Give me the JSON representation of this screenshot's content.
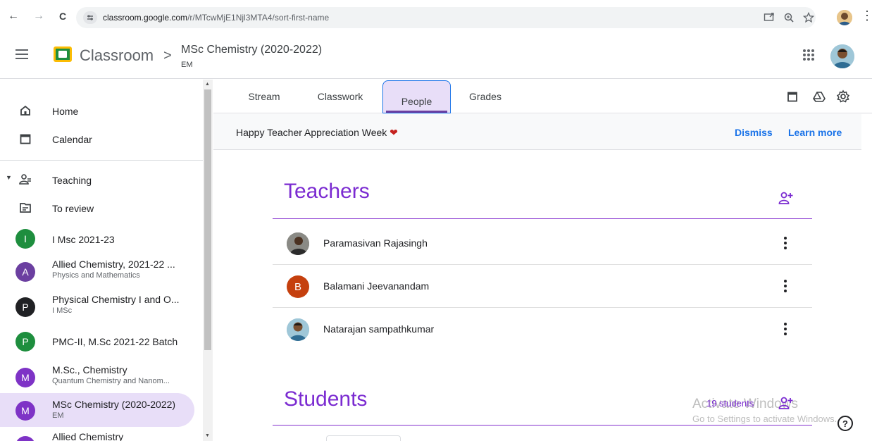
{
  "browser": {
    "back_icon": "←",
    "forward_icon": "→",
    "reload_icon": "C",
    "url_host": "classroom.google.com",
    "url_path": "/r/MTcwMjE1Njl3MTA4/sort-first-name",
    "kebab": "⋮"
  },
  "header": {
    "app_title": "Classroom",
    "crumb_separator": ">",
    "course_title": "MSc Chemistry (2020-2022)",
    "course_section": "EM"
  },
  "sidebar": {
    "home": "Home",
    "calendar": "Calendar",
    "teaching": "Teaching",
    "to_review": "To review",
    "courses": [
      {
        "letter": "I",
        "color": "#1e8e3e",
        "name": "I Msc 2021-23",
        "sub": ""
      },
      {
        "letter": "A",
        "color": "#6b3fa0",
        "name": "Allied Chemistry, 2021-22 ...",
        "sub": "Physics and Mathematics"
      },
      {
        "letter": "P",
        "color": "#202124",
        "name": "Physical Chemistry I and O...",
        "sub": "I MSc"
      },
      {
        "letter": "P",
        "color": "#1e8e3e",
        "name": "PMC-II, M.Sc 2021-22 Batch",
        "sub": ""
      },
      {
        "letter": "M",
        "color": "#7e33c6",
        "name": "M.Sc., Chemistry",
        "sub": "Quantum Chemistry and Nanom..."
      },
      {
        "letter": "M",
        "color": "#7e33c6",
        "name": "MSc Chemistry (2020-2022)",
        "sub": "EM"
      },
      {
        "letter": "A",
        "color": "#7e33c6",
        "name": "Allied Chemistry",
        "sub": ""
      }
    ]
  },
  "tabs": [
    "Stream",
    "Classwork",
    "People",
    "Grades"
  ],
  "banner": {
    "text": "Happy Teacher Appreciation Week",
    "heart": "❤",
    "dismiss": "Dismiss",
    "learn_more": "Learn more"
  },
  "teachers": {
    "title": "Teachers",
    "people": [
      {
        "name": "Paramasivan Rajasingh",
        "avatar": "photo",
        "letter": ""
      },
      {
        "name": "Balamani Jeevanandam",
        "avatar": "letter",
        "letter": "B",
        "color": "#c5400e"
      },
      {
        "name": "Natarajan sampathkumar",
        "avatar": "photo",
        "letter": ""
      }
    ]
  },
  "students": {
    "title": "Students",
    "count": "19 students"
  },
  "watermark": {
    "line1": "Activate Windows",
    "line2": "Go to Settings to activate Windows."
  },
  "help": "?"
}
